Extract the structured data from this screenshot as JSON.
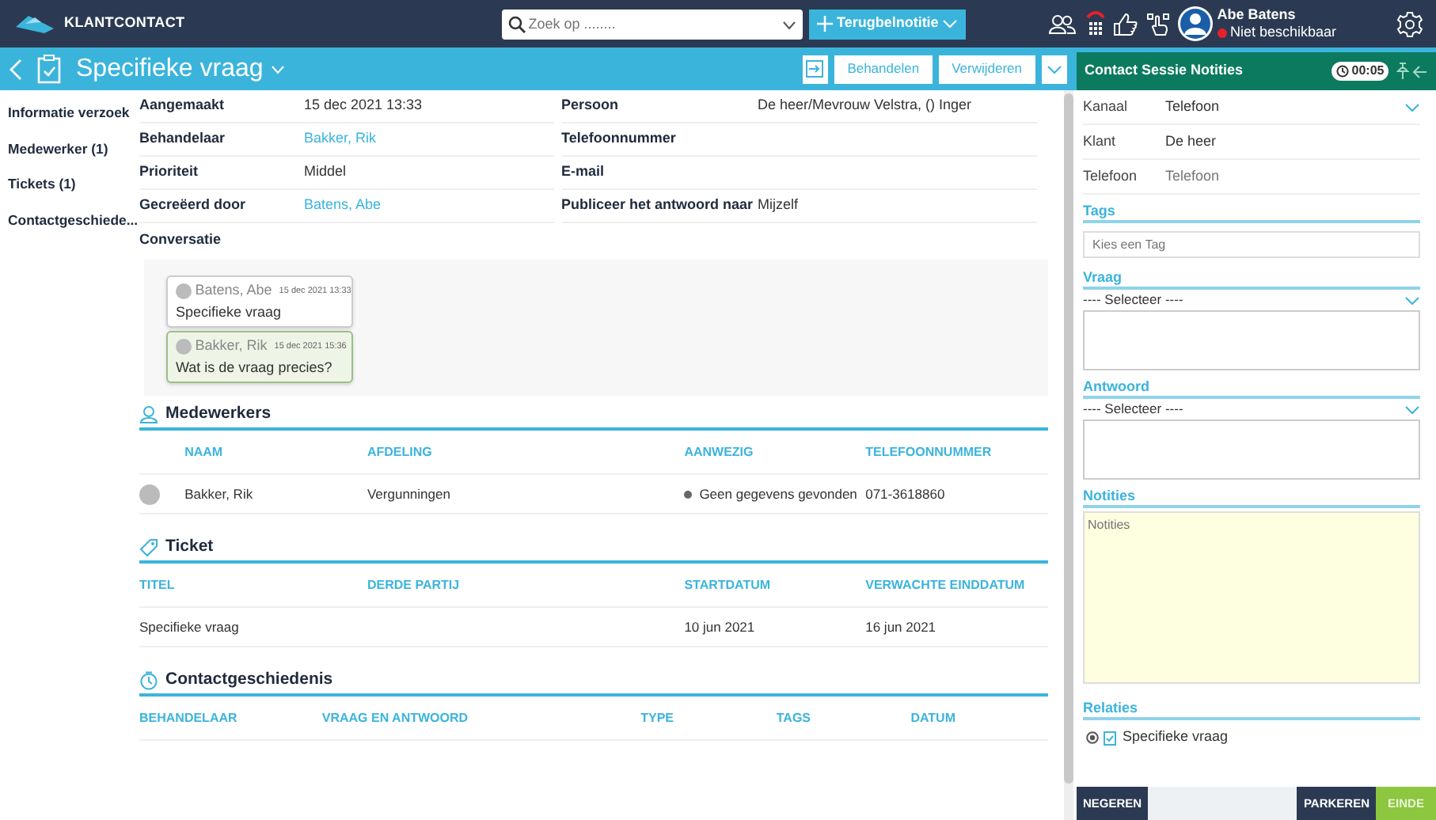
{
  "topbar": {
    "app_name": "KLANTCONTACT",
    "search": {
      "placeholder": "Zoek op ........"
    },
    "new_button": "Terugbelnotitie",
    "user": {
      "name": "Abe Batens",
      "status": "Niet beschikbaar"
    }
  },
  "page_header": {
    "title": "Specifieke vraag",
    "actions": [
      "Behandelen",
      "Verwijderen"
    ]
  },
  "side_nav": [
    "Informatie verzoek",
    "Medewerker (1)",
    "Tickets (1)",
    "Contactgeschiede..."
  ],
  "fields_left": [
    {
      "label": "Aangemaakt",
      "value": "15 dec 2021 13:33",
      "kind": "text"
    },
    {
      "label": "Behandelaar",
      "value": "Bakker, Rik",
      "kind": "link"
    },
    {
      "label": "Prioriteit",
      "value": "Middel",
      "kind": "text"
    },
    {
      "label": "Gecreëerd door",
      "value": "Batens, Abe",
      "kind": "link"
    },
    {
      "label": "Conversatie",
      "kind": "heading"
    }
  ],
  "fields_right": [
    {
      "label": "Persoon",
      "value": "De heer/Mevrouw Velstra, () Inger"
    },
    {
      "label": "Telefoonnummer"
    },
    {
      "label": "E-mail"
    },
    {
      "label": "Publiceer het antwoord naar",
      "value": "Mijzelf"
    }
  ],
  "conversation": [
    {
      "author": "Batens, Abe",
      "time": "15 dec 2021 13:33",
      "text": "Specifieke vraag",
      "kind": "sent"
    },
    {
      "author": "Bakker, Rik",
      "time": "15 dec 2021 15:36",
      "text": "Wat is de vraag precies?",
      "kind": "reply"
    }
  ],
  "sections": [
    {
      "title": "Medewerkers",
      "kind": "people",
      "columns": [
        {
          "kind": "avatar"
        },
        {
          "label": "NAAM",
          "kind": "text"
        },
        {
          "label": "AFDELING",
          "kind": "text"
        },
        {
          "label": "AANWEZIG",
          "kind": "presence"
        },
        {
          "label": "TELEFOONNUMMER",
          "kind": "text"
        }
      ],
      "rows": [
        [
          "",
          "Bakker, Rik",
          "Vergunningen",
          "Geen gegevens gevonden",
          "071-3618860"
        ]
      ]
    },
    {
      "title": "Ticket",
      "kind": "ticket",
      "columns": [
        {
          "label": "TITEL",
          "kind": "text"
        },
        {
          "label": "DERDE PARTIJ",
          "kind": "text"
        },
        {
          "label": "STARTDATUM",
          "kind": "text"
        },
        {
          "label": "VERWACHTE EINDDATUM",
          "kind": "text"
        }
      ],
      "rows": [
        [
          "Specifieke vraag",
          "",
          "10 jun 2021",
          "16 jun 2021"
        ]
      ]
    },
    {
      "title": "Contactgeschiedenis",
      "kind": "history",
      "columns": [
        {
          "label": "BEHANDELAAR"
        },
        {
          "label": "VRAAG EN ANTWOORD"
        },
        {
          "label": "TYPE"
        },
        {
          "label": "TAGS"
        },
        {
          "label": "DATUM"
        }
      ]
    }
  ],
  "session_panel": {
    "title": "Contact Sessie Notities",
    "timer": "00:05",
    "info": [
      {
        "label": "Kanaal",
        "value": "Telefoon",
        "kind": "select"
      },
      {
        "label": "Klant",
        "value": "De heer",
        "kind": "text"
      },
      {
        "label": "Telefoon",
        "placeholder": "Telefoon",
        "kind": "input"
      }
    ],
    "tags": {
      "title": "Tags",
      "placeholder": "Kies een Tag"
    },
    "vraag": {
      "title": "Vraag",
      "select": "---- Selecteer ----"
    },
    "antwoord": {
      "title": "Antwoord",
      "select": "---- Selecteer ----"
    },
    "notities": {
      "title": "Notities",
      "placeholder": "Notities"
    },
    "relaties": {
      "title": "Relaties",
      "items": [
        "Specifieke vraag"
      ]
    },
    "buttons": [
      {
        "label": "NEGEREN",
        "kind": "dark"
      },
      {
        "label": "PARKEREN",
        "kind": "dark"
      },
      {
        "label": "EINDE",
        "kind": "go"
      }
    ]
  }
}
